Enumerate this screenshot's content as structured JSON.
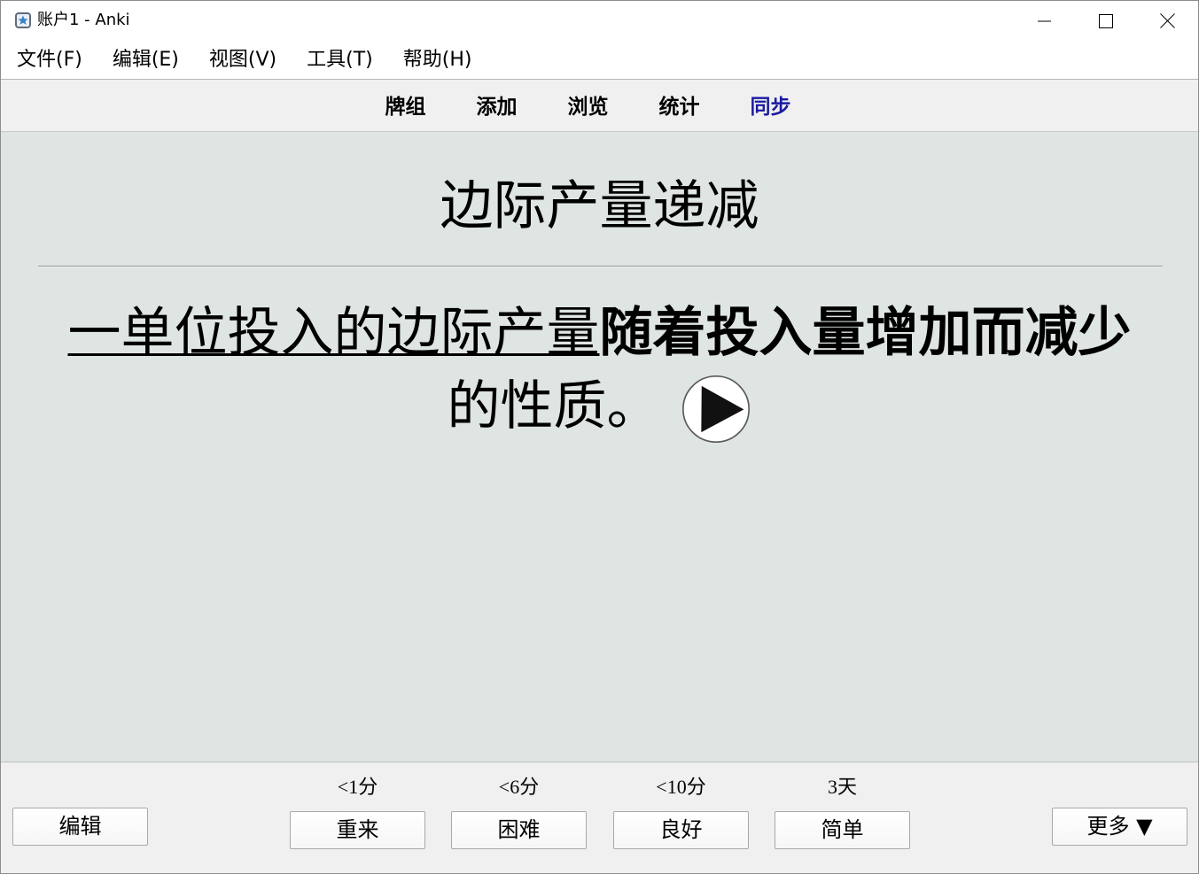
{
  "window": {
    "title": "账户1 - Anki",
    "app_icon": "anki-app-icon",
    "controls": [
      "minimize-icon",
      "maximize-icon",
      "close-icon"
    ]
  },
  "menubar": {
    "items": [
      "文件(F)",
      "编辑(E)",
      "视图(V)",
      "工具(T)",
      "帮助(H)"
    ]
  },
  "toolbar": {
    "items": [
      "牌组",
      "添加",
      "浏览",
      "统计",
      "同步"
    ],
    "sync_color": "#1a1aa0"
  },
  "card": {
    "background": "#dee5e3",
    "front": "边际产量递减",
    "back": {
      "underlined": "一单位投入的边际产量",
      "bold": "随着投入量增加而减少",
      "plain": "的性质。"
    },
    "replay_icon": "play-icon"
  },
  "bottom_bar": {
    "edit_label": "编辑",
    "more_label": "更多 ▼",
    "answers": [
      {
        "interval": "<1分",
        "label": "重来"
      },
      {
        "interval": "<6分",
        "label": "困难"
      },
      {
        "interval": "<10分",
        "label": "良好"
      },
      {
        "interval": "3天",
        "label": "简单"
      }
    ]
  }
}
